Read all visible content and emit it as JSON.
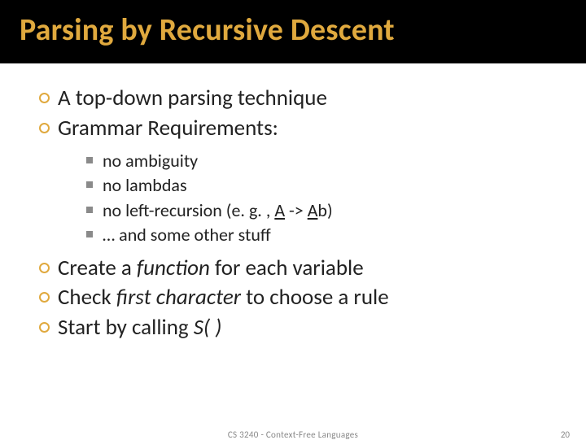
{
  "title": "Parsing by Recursive Descent",
  "bullets": {
    "b0": "A top-down parsing technique",
    "b1": "Grammar Requirements:",
    "sub": {
      "s0": "no ambiguity",
      "s1": "no lambdas",
      "s2_pre": "no left-recursion (e. g. , ",
      "s2_a1": "A",
      "s2_mid": " -> ",
      "s2_a2": "A",
      "s2_post": "b)",
      "s3": "… and some other stuff"
    },
    "b2_pre": "Create a ",
    "b2_em": "function",
    "b2_post": " for each variable",
    "b3_pre": "Check ",
    "b3_em": "first character",
    "b3_post": " to choose a rule",
    "b4_pre": "Start by calling ",
    "b4_em": "S( )"
  },
  "footer": {
    "course": "CS 3240 - Context-Free Languages",
    "page": "20"
  }
}
